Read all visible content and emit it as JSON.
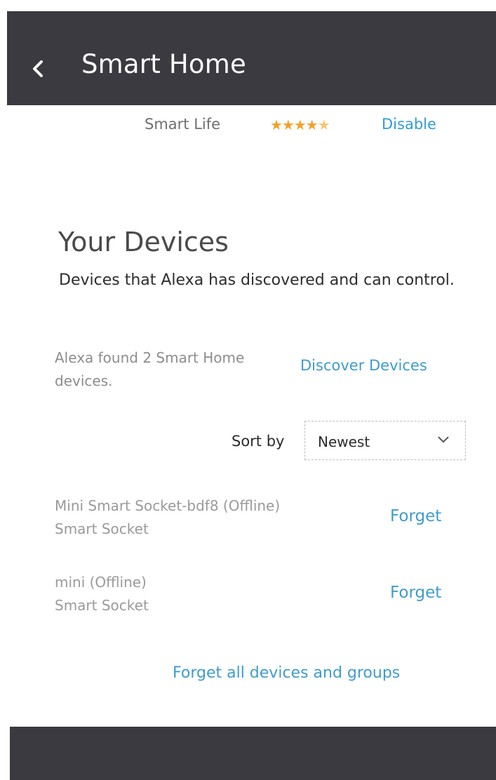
{
  "header": {
    "back_icon": "chevron-left-icon",
    "title": "Smart Home"
  },
  "skill": {
    "name": "Smart Life",
    "rating": 4.5,
    "rating_stars": "★★★★",
    "rating_half": "★",
    "disable_label": "Disable",
    "star_color": "#f0a22c"
  },
  "devices_section": {
    "title": "Your Devices",
    "description": "Devices that Alexa has discovered and can control.",
    "found_text": "Alexa found 2 Smart Home devices.",
    "discover_label": "Discover Devices"
  },
  "sort": {
    "label": "Sort by",
    "selected": "Newest",
    "chevron_icon": "chevron-down-icon"
  },
  "devices": [
    {
      "name": "Mini Smart Socket-bdf8 (Offline)",
      "type": "Smart Socket",
      "forget_label": "Forget"
    },
    {
      "name": "mini (Offline)",
      "type": "Smart Socket",
      "forget_label": "Forget"
    }
  ],
  "forget_all_label": "Forget all devices and groups",
  "colors": {
    "header_bg": "#3b3a40",
    "link": "#3f9ccc"
  }
}
